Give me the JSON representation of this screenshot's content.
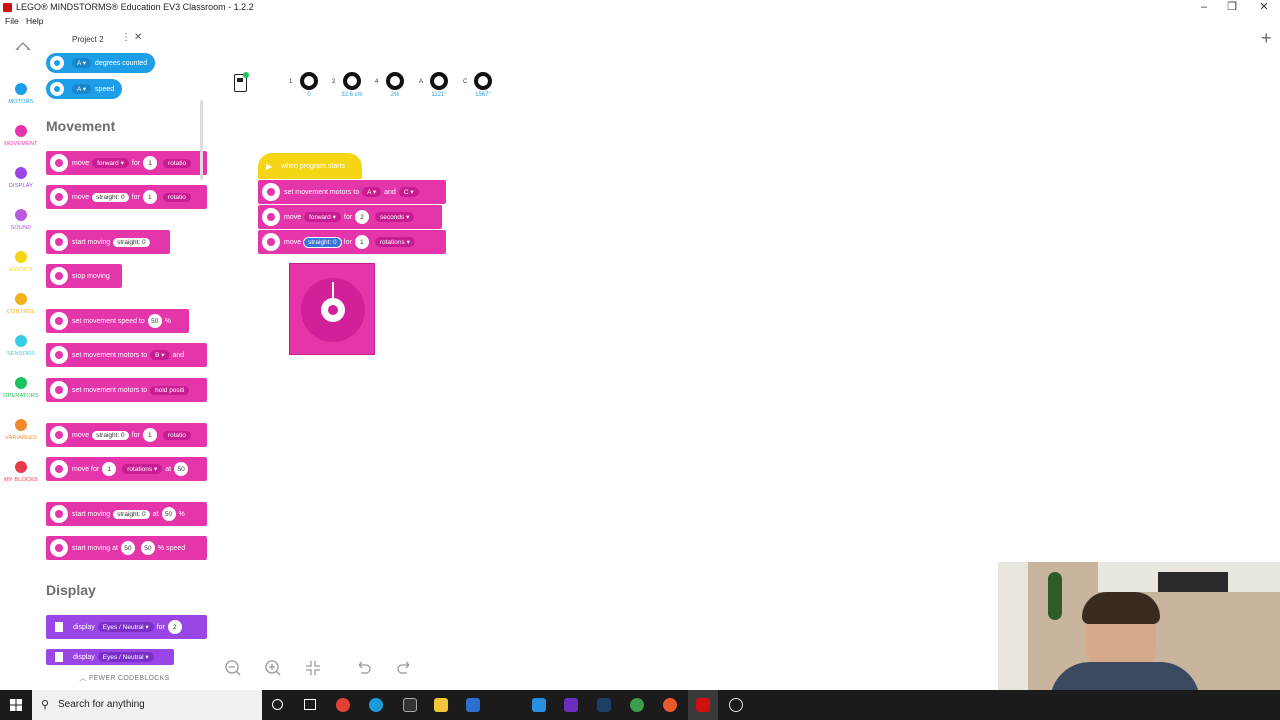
{
  "window": {
    "title": "LEGO® MINDSTORMS® Education EV3 Classroom - 1.2.2",
    "minimize": "–",
    "maximize": "❐",
    "close": "✕"
  },
  "menu": {
    "file": "File",
    "help": "Help"
  },
  "tab": {
    "label": "Project 2",
    "more": "⋮",
    "close": "✕",
    "add": "+"
  },
  "nav": [
    {
      "label": "MOTORS",
      "color": "#1e9ee8"
    },
    {
      "label": "MOVEMENT",
      "color": "#e535ab"
    },
    {
      "label": "DISPLAY",
      "color": "#9a45e5"
    },
    {
      "label": "SOUND",
      "color": "#b85be0"
    },
    {
      "label": "EVENTS",
      "color": "#f5d614"
    },
    {
      "label": "CONTROL",
      "color": "#f2b01a"
    },
    {
      "label": "SENSORS",
      "color": "#35cde6"
    },
    {
      "label": "OPERATORS",
      "color": "#1cc35a"
    },
    {
      "label": "VARIABLES",
      "color": "#f08a2c"
    },
    {
      "label": "MY BLOCKS",
      "color": "#e63a4a"
    }
  ],
  "palette": {
    "motor_blocks": [
      {
        "port": "A ▾",
        "label": "degrees counted"
      },
      {
        "port": "A ▾",
        "label": "speed"
      }
    ],
    "movement_title": "Movement",
    "display_title": "Display",
    "fewer": "FEWER CODEBLOCKS",
    "b1": {
      "t1": "move",
      "d1": "forward ▾",
      "t2": "for",
      "n": "1",
      "t3": "rotatio"
    },
    "b2": {
      "t1": "move",
      "p": "straight: 0",
      "t2": "for",
      "n": "1",
      "t3": "rotatio"
    },
    "b3": {
      "t1": "start moving",
      "p": "straight: 0"
    },
    "b4": {
      "t1": "stop moving"
    },
    "b5": {
      "t1": "set movement speed to",
      "n": "50",
      "t2": "%"
    },
    "b6": {
      "t1": "set movement motors to",
      "d": "B ▾",
      "t2": "and"
    },
    "b7": {
      "t1": "set movement motors to",
      "t2": "hold positi"
    },
    "b8": {
      "t1": "move",
      "p": "straight: 0",
      "t2": "for",
      "n": "1",
      "t3": "rotatio"
    },
    "b9": {
      "t1": "move for",
      "n": "1",
      "d": "rotations ▾",
      "t2": "at",
      "n2": "50"
    },
    "b10": {
      "t1": "start moving",
      "p": "straight: 0",
      "t2": "at",
      "n": "50",
      "t3": "%"
    },
    "b11": {
      "t1": "start moving at",
      "n1": "50",
      "n2": "50",
      "t2": "% speed"
    },
    "d1": {
      "t1": "display",
      "d": "Eyes / Neutral ▾",
      "t2": "for",
      "n": "2"
    },
    "d2": {
      "t1": "display",
      "d": "Eyes / Neutral ▾"
    }
  },
  "ports": [
    {
      "id": "1",
      "value": "0"
    },
    {
      "id": "2",
      "value": "32.6 cm"
    },
    {
      "id": "4",
      "value": "2%"
    },
    {
      "id": "A",
      "value": "1121°"
    },
    {
      "id": "C",
      "value": "1567°"
    }
  ],
  "program": {
    "hat": "when program starts",
    "s1": {
      "t1": "set movement motors to",
      "d1": "A ▾",
      "t2": "and",
      "d2": "C ▾"
    },
    "s2": {
      "t1": "move",
      "d1": "forward ▾",
      "t2": "for",
      "n": "2",
      "d2": "seconds ▾"
    },
    "s3": {
      "t1": "move",
      "p": "straight: 0",
      "t2": "for",
      "n": "1",
      "d2": "rotations ▾"
    }
  },
  "taskbar": {
    "search": "Search for anything"
  }
}
